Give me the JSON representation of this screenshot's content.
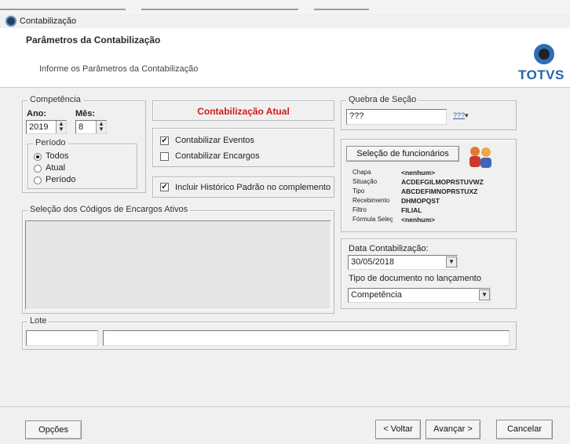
{
  "window": {
    "title": "Contabilização"
  },
  "header": {
    "title": "Parâmetros da Contabilização",
    "subtitle": "Informe os Parâmetros da Contabilização",
    "logo_text": "TOTVS"
  },
  "competencia": {
    "legend": "Competência",
    "ano_label": "Ano:",
    "ano_value": "2019",
    "mes_label": "Mês:",
    "mes_value": "8",
    "periodo": {
      "legend": "Período",
      "options": [
        "Todos",
        "Atual",
        "Período"
      ],
      "selected": "Todos"
    }
  },
  "contabilizacao_atual": {
    "label": "Contabilização Atual",
    "color": "#d11a1a"
  },
  "contabilizar": {
    "eventos_label": "Contabilizar Eventos",
    "eventos_checked": true,
    "encargos_label": "Contabilizar Encargos",
    "encargos_checked": false
  },
  "historico": {
    "label": "Incluir Histórico Padrão no complemento",
    "checked": true
  },
  "encargos_ativos": {
    "legend": "Seleção dos Códigos de Encargos Ativos"
  },
  "quebra_secao": {
    "legend": "Quebra de Seção",
    "value": "???",
    "icon_text": "???"
  },
  "selecao_funcionarios": {
    "button_label": "Seleção de funcionários",
    "rows": [
      {
        "label": "Chapa",
        "value": "<nenhum>"
      },
      {
        "label": "Situação",
        "value": "ACDEFGILMOPRSTUVWZ"
      },
      {
        "label": "Tipo",
        "value": "ABCDEFIMNOPRSTUXZ"
      },
      {
        "label": "Recebimento",
        "value": "DHMOPQST"
      },
      {
        "label": "Filtro",
        "value": "FILIAL"
      },
      {
        "label": "Fórmula Seleç",
        "value": "<nenhum>"
      }
    ]
  },
  "data_contabilizacao": {
    "label": "Data Contabilização:",
    "value": "30/05/2018",
    "tipo_label": "Tipo de documento no lançamento",
    "tipo_value": "Competência"
  },
  "lote": {
    "legend": "Lote",
    "code": "",
    "description": ""
  },
  "footer": {
    "opcoes_label": "Opções",
    "voltar_label": "< Voltar",
    "avancar_label": "Avançar >",
    "cancelar_label": "Cancelar"
  }
}
